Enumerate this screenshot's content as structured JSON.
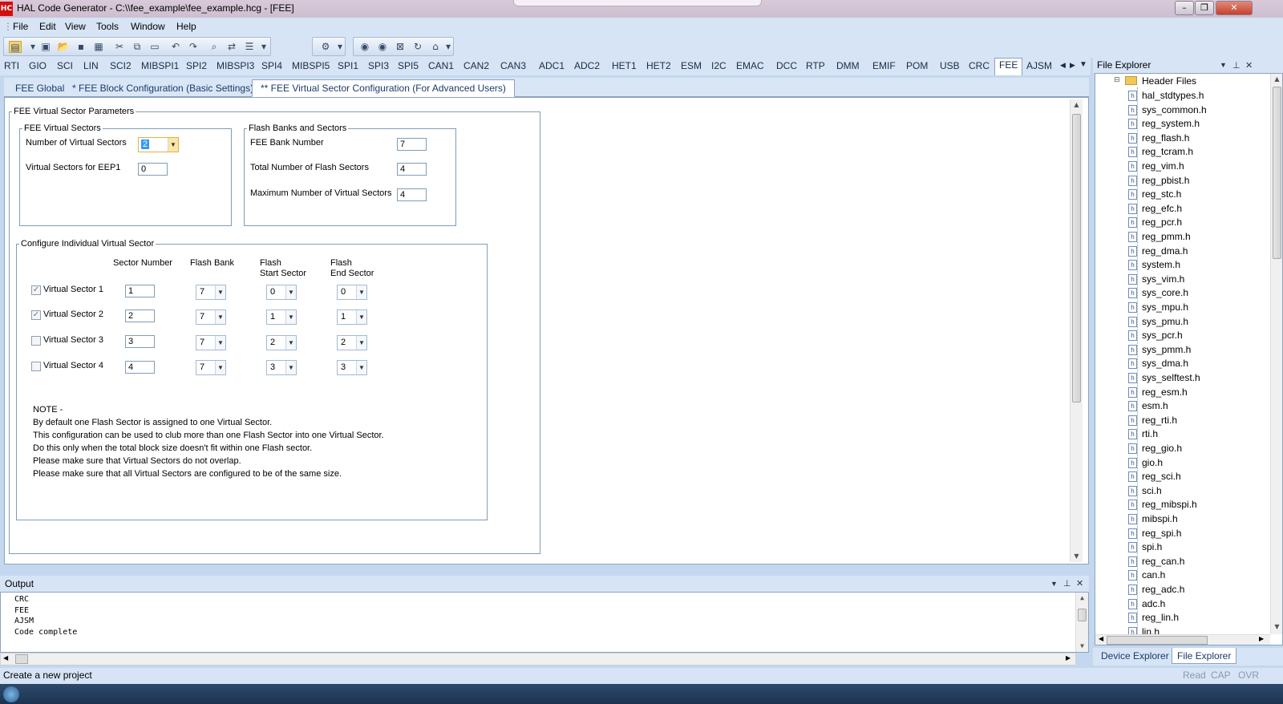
{
  "window": {
    "logo": "HC",
    "title": "HAL Code Generator - C:\\\\fee_example\\fee_example.hcg - [FEE]"
  },
  "menu": [
    "File",
    "Edit",
    "View",
    "Tools",
    "Window",
    "Help"
  ],
  "module_tabs": [
    "RTI",
    "GIO",
    "SCI",
    "LIN",
    "SCI2",
    "MIBSPI1",
    "SPI2",
    "MIBSPI3",
    "SPI4",
    "MIBSPI5",
    "SPI1",
    "SPI3",
    "SPI5",
    "CAN1",
    "CAN2",
    "CAN3",
    "ADC1",
    "ADC2",
    "HET1",
    "HET2",
    "ESM",
    "I2C",
    "EMAC",
    "DCC",
    "RTP",
    "DMM",
    "EMIF",
    "POM",
    "USB",
    "CRC",
    "FEE",
    "AJSM"
  ],
  "active_module": "FEE",
  "sub_tabs": [
    "FEE Global",
    "* FEE Block Configuration (Basic Settings)",
    "** FEE Virtual Sector Configuration (For Advanced Users)"
  ],
  "params": {
    "group_title": "FEE Virtual Sector Parameters",
    "virtual_sectors": {
      "title": "FEE Virtual Sectors",
      "num_label": "Number of Virtual Sectors",
      "num_value": "2",
      "eep1_label": "Virtual Sectors for EEP1",
      "eep1_value": "0"
    },
    "flash_banks": {
      "title": "Flash Banks and Sectors",
      "bank_label": "FEE Bank Number",
      "bank_value": "7",
      "total_label": "Total Number of Flash Sectors",
      "total_value": "4",
      "max_label": "Maximum Number of Virtual Sectors",
      "max_value": "4"
    }
  },
  "individual": {
    "title": "Configure Individual Virtual Sector",
    "headers": {
      "sector_number": "Sector Number",
      "flash_bank": "Flash Bank",
      "start_1": "Flash",
      "start_2": "Start Sector",
      "end_1": "Flash",
      "end_2": "End Sector"
    },
    "rows": [
      {
        "label": "Virtual Sector 1",
        "checked": true,
        "sector": "1",
        "bank": "7",
        "start": "0",
        "end": "0"
      },
      {
        "label": "Virtual Sector 2",
        "checked": true,
        "sector": "2",
        "bank": "7",
        "start": "1",
        "end": "1"
      },
      {
        "label": "Virtual Sector 3",
        "checked": false,
        "sector": "3",
        "bank": "7",
        "start": "2",
        "end": "2"
      },
      {
        "label": "Virtual Sector 4",
        "checked": false,
        "sector": "4",
        "bank": "7",
        "start": "3",
        "end": "3"
      }
    ],
    "note": [
      "NOTE -",
      "By default one Flash Sector is assigned to one Virtual Sector.",
      "This configuration can be used to club more than one Flash Sector into one Virtual Sector.",
      "Do this only when the total block size doesn't fit within one Flash sector.",
      "Please make sure that Virtual Sectors do not overlap.",
      "Please make sure that all Virtual Sectors are configured to be of the same size."
    ]
  },
  "output": {
    "title": "Output",
    "lines": [
      "CRC",
      "FEE",
      "AJSM",
      "Code complete"
    ]
  },
  "status": {
    "text": "Create a new project",
    "read": "Read",
    "cap": "CAP",
    "ovr": "OVR"
  },
  "explorer": {
    "title": "File Explorer",
    "folder": "Header Files",
    "files": [
      "hal_stdtypes.h",
      "sys_common.h",
      "reg_system.h",
      "reg_flash.h",
      "reg_tcram.h",
      "reg_vim.h",
      "reg_pbist.h",
      "reg_stc.h",
      "reg_efc.h",
      "reg_pcr.h",
      "reg_pmm.h",
      "reg_dma.h",
      "system.h",
      "sys_vim.h",
      "sys_core.h",
      "sys_mpu.h",
      "sys_pmu.h",
      "sys_pcr.h",
      "sys_pmm.h",
      "sys_dma.h",
      "sys_selftest.h",
      "reg_esm.h",
      "esm.h",
      "reg_rti.h",
      "rti.h",
      "reg_gio.h",
      "gio.h",
      "reg_sci.h",
      "sci.h",
      "reg_mibspi.h",
      "mibspi.h",
      "reg_spi.h",
      "spi.h",
      "reg_can.h",
      "can.h",
      "reg_adc.h",
      "adc.h",
      "reg_lin.h",
      "lin.h"
    ],
    "bottom_tabs": [
      "Device Explorer",
      "File Explorer"
    ],
    "file_icon": "h"
  }
}
